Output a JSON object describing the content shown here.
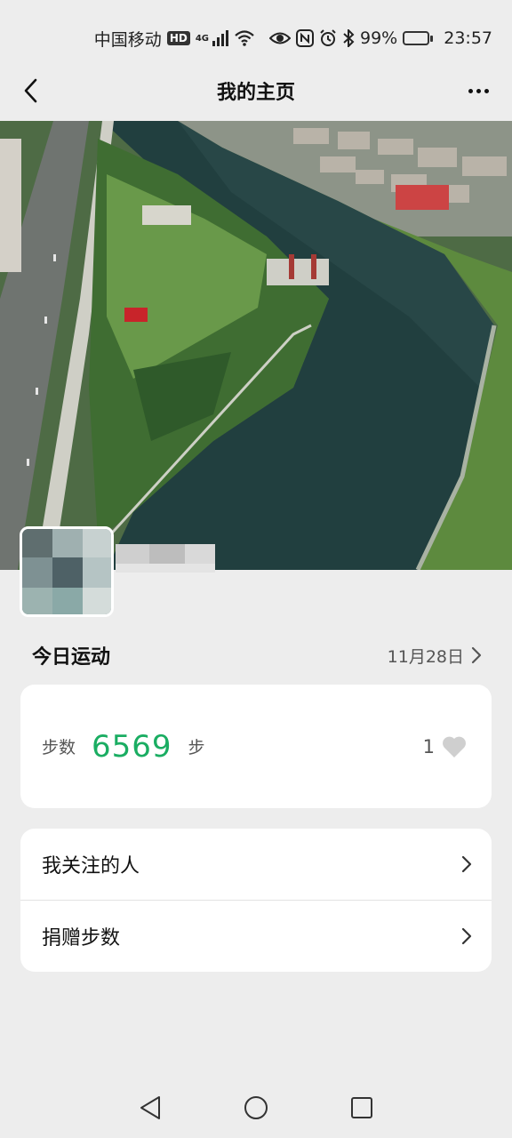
{
  "status_bar": {
    "carrier": "中国移动",
    "hd_badge": "HD",
    "network": "4G",
    "battery": "99%",
    "time": "23:57"
  },
  "header": {
    "title": "我的主页",
    "back_icon": "chevron-left-icon",
    "more_icon": "more-dots-icon"
  },
  "today": {
    "title": "今日运动",
    "date": "11月28日"
  },
  "steps": {
    "label": "步数",
    "value": "6569",
    "unit": "步",
    "likes": "1",
    "accent_color": "#1aad62"
  },
  "menu": {
    "items": [
      {
        "label": "我关注的人"
      },
      {
        "label": "捐赠步数"
      }
    ]
  }
}
